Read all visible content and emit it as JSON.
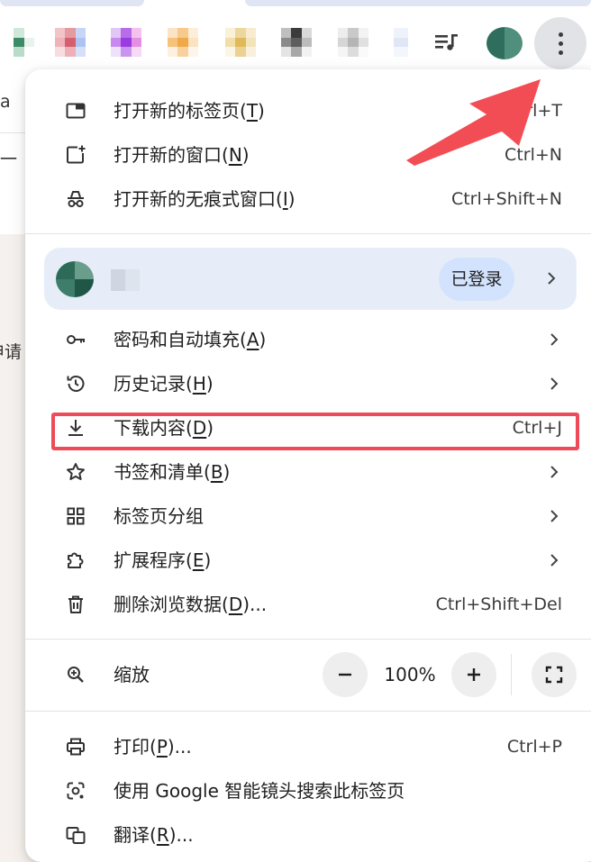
{
  "toolbar": {
    "kebab_label": "Customize and control"
  },
  "menu": {
    "group1": [
      {
        "label": "打开新的标签页(T)",
        "shortcut": "Ctrl+T",
        "icon": "new-tab-icon"
      },
      {
        "label": "打开新的窗口(N)",
        "shortcut": "Ctrl+N",
        "icon": "new-window-icon"
      },
      {
        "label": "打开新的无痕式窗口(I)",
        "shortcut": "Ctrl+Shift+N",
        "icon": "incognito-icon"
      }
    ],
    "profile": {
      "status": "已登录"
    },
    "group2": [
      {
        "label": "密码和自动填充(A)",
        "icon": "key-icon"
      },
      {
        "label": "历史记录(H)",
        "icon": "history-icon"
      },
      {
        "label": "下载内容(D)",
        "shortcut": "Ctrl+J",
        "icon": "download-icon"
      },
      {
        "label": "书签和清单(B)",
        "icon": "star-icon"
      },
      {
        "label": "标签页分组",
        "icon": "tab-groups-icon"
      },
      {
        "label": "扩展程序(E)",
        "icon": "extension-icon"
      },
      {
        "label": "删除浏览数据(D)...",
        "shortcut": "Ctrl+Shift+Del",
        "icon": "trash-icon"
      }
    ],
    "zoom": {
      "label": "缩放",
      "value": "100%",
      "minus": "−",
      "plus": "+"
    },
    "group3": [
      {
        "label": "打印(P)...",
        "shortcut": "Ctrl+P",
        "icon": "print-icon"
      },
      {
        "label": "使用 Google 智能镜头搜索此标签页",
        "icon": "google-lens-icon"
      },
      {
        "label": "翻译(R)...",
        "icon": "translate-icon"
      }
    ]
  },
  "background_page": {
    "fragments": [
      "a",
      "一",
      "申请"
    ]
  },
  "colors": {
    "highlight_box": "#ef4a58",
    "annotation_arrow": "#f24d55",
    "menu_background": "#ffffff",
    "profile_background": "#e6edf9",
    "badge_background": "#d3e3fd"
  }
}
